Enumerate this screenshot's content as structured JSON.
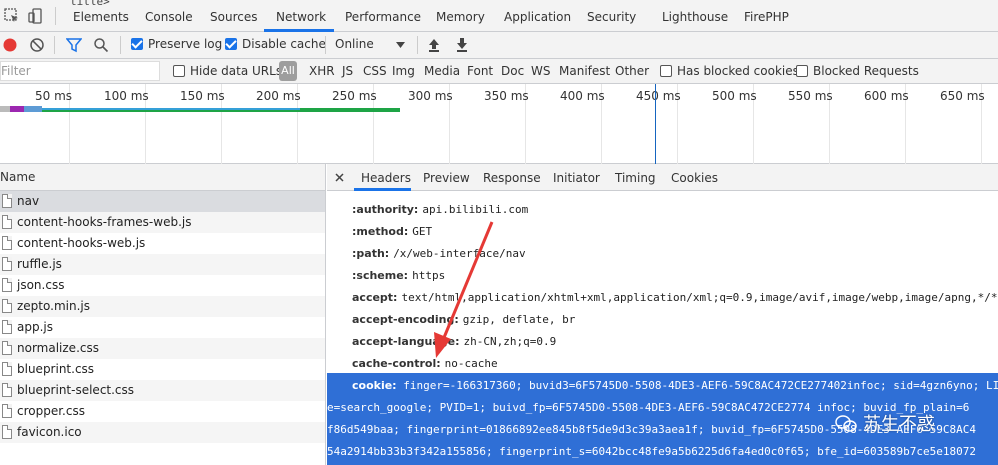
{
  "window": {
    "title_fragment": "title>"
  },
  "devtools_tabs": [
    {
      "label": "Elements"
    },
    {
      "label": "Console"
    },
    {
      "label": "Sources"
    },
    {
      "label": "Network"
    },
    {
      "label": "Performance"
    },
    {
      "label": "Memory"
    },
    {
      "label": "Application"
    },
    {
      "label": "Security"
    },
    {
      "label": "Lighthouse"
    },
    {
      "label": "FirePHP"
    }
  ],
  "active_tab": "Network",
  "toolbar": {
    "preserve_log": "Preserve log",
    "preserve_log_checked": true,
    "disable_cache": "Disable cache",
    "disable_cache_checked": true,
    "throttling": "Online"
  },
  "filter": {
    "placeholder": "Filter",
    "hide_data_urls": "Hide data URLs",
    "all": "All",
    "types": [
      "XHR",
      "JS",
      "CSS",
      "Img",
      "Media",
      "Font",
      "Doc",
      "WS",
      "Manifest",
      "Other"
    ],
    "has_blocked_cookies": "Has blocked cookies",
    "blocked_requests": "Blocked Requests"
  },
  "timeline": {
    "ticks": [
      "50 ms",
      "100 ms",
      "150 ms",
      "200 ms",
      "250 ms",
      "300 ms",
      "350 ms",
      "400 ms",
      "450 ms",
      "500 ms",
      "550 ms",
      "600 ms",
      "650 ms"
    ]
  },
  "request_list": {
    "header": "Name",
    "files": [
      {
        "name": "nav"
      },
      {
        "name": "content-hooks-frames-web.js"
      },
      {
        "name": "content-hooks-web.js"
      },
      {
        "name": "ruffle.js"
      },
      {
        "name": "json.css"
      },
      {
        "name": "zepto.min.js"
      },
      {
        "name": "app.js"
      },
      {
        "name": "normalize.css"
      },
      {
        "name": "blueprint.css"
      },
      {
        "name": "blueprint-select.css"
      },
      {
        "name": "cropper.css"
      },
      {
        "name": "favicon.ico"
      }
    ]
  },
  "detail_tabs": [
    {
      "label": "Headers"
    },
    {
      "label": "Preview"
    },
    {
      "label": "Response"
    },
    {
      "label": "Initiator"
    },
    {
      "label": "Timing"
    },
    {
      "label": "Cookies"
    }
  ],
  "headers": [
    {
      "key": ":authority:",
      "value": "api.bilibili.com"
    },
    {
      "key": ":method:",
      "value": "GET"
    },
    {
      "key": ":path:",
      "value": "/x/web-interface/nav"
    },
    {
      "key": ":scheme:",
      "value": "https"
    },
    {
      "key": "accept:",
      "value": "text/html,application/xhtml+xml,application/xml;q=0.9,image/avif,image/webp,image/apng,*/*;"
    },
    {
      "key": "accept-encoding:",
      "value": "gzip, deflate, br"
    },
    {
      "key": "accept-language:",
      "value": "zh-CN,zh;q=0.9"
    },
    {
      "key": "cache-control:",
      "value": "no-cache"
    }
  ],
  "cookie": {
    "key": "cookie:",
    "lines": [
      "finger=-166317360; buvid3=6F5745D0-5508-4DE3-AEF6-59C8AC472CE277402infoc; sid=4gzn6yno; LIV",
      "e=search_google; PVID=1; buivd_fp=6F5745D0-5508-4DE3-AEF6-59C8AC472CE2774 infoc; buvid_fp_plain=6",
      "f86d549baa; fingerprint=01866892ee845b8f5de9d3c39a3aea1f; buvid_fp=6F5745D0-5508-4DE3-AEF6-59C8AC4",
      "54a2914bb33b3f342a155856; fingerprint_s=6042bcc48fe9a5b6225d6fa4ed0c0f65; bfe_id=603589b7ce5e18072"
    ]
  },
  "watermark": "苏生不惑",
  "colors": {
    "accent": "#1a73e8",
    "selection": "#2f6fd6",
    "arrow": "#e53935"
  }
}
